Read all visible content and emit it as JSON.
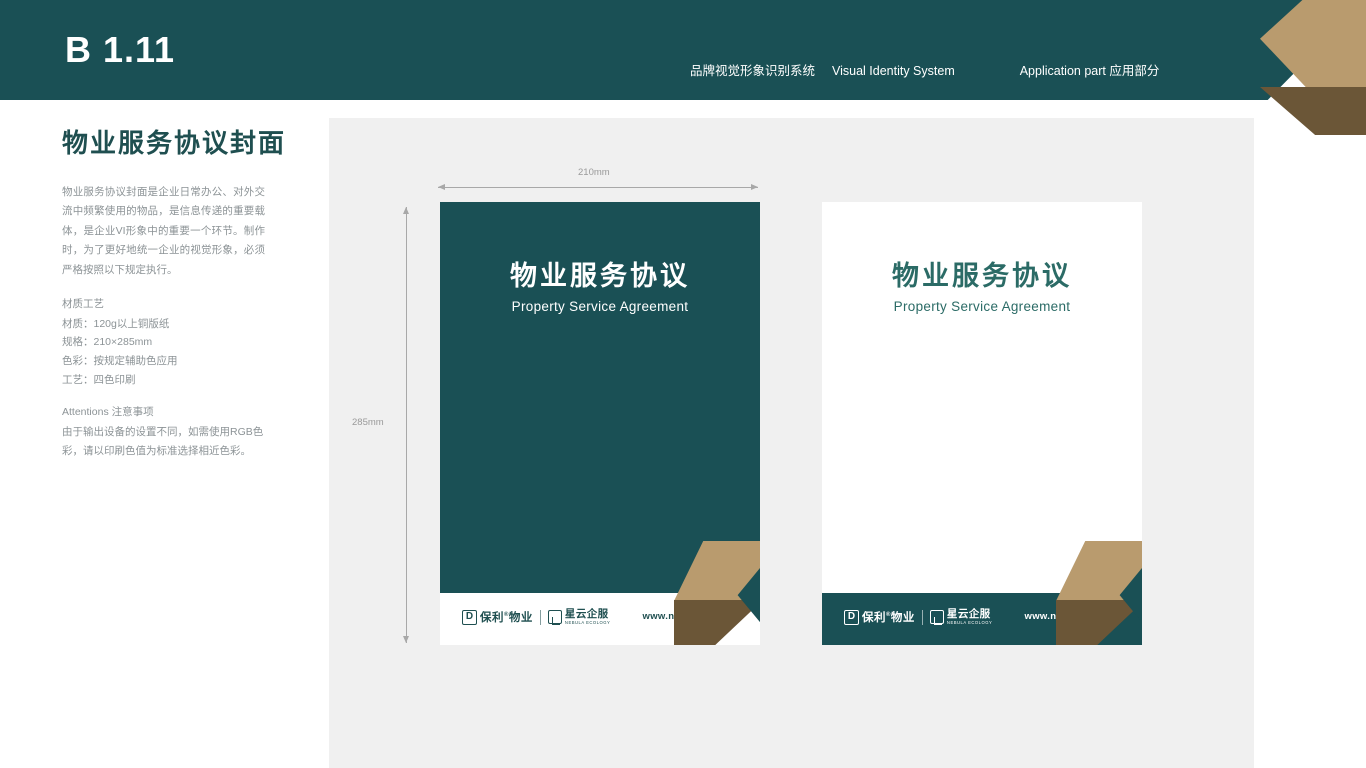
{
  "header": {
    "code": "B 1.11",
    "meta_cn": "品牌视觉形象识别系统",
    "meta_en": "Visual Identity System",
    "section": "Application part  应用部分",
    "bg_color": "#1a5055",
    "accent_tan": "#b99b6e",
    "accent_brown": "#6b5637"
  },
  "sidebar": {
    "title": "物业服务协议封面",
    "intro": "物业服务协议封面是企业日常办公、对外交流中频繁使用的物品，是信息传递的重要载体，是企业VI形象中的重要一个环节。制作时，为了更好地统一企业的视觉形象，必须严格按照以下规定执行。",
    "spec_heading": "材质工艺",
    "specs": [
      "材质：120g以上铜版纸",
      "规格：210×285mm",
      "色彩：按规定辅助色应用",
      "工艺：四色印刷"
    ],
    "attentions_heading": "Attentions 注意事项",
    "attentions_body": "由于输出设备的设置不同，如需使用RGB色彩，请以印刷色值为标准选择相近色彩。"
  },
  "stage": {
    "dim_width_label": "210mm",
    "dim_height_label": "285mm",
    "bg_color": "#f0f0f0"
  },
  "covers": [
    {
      "variant": "dark",
      "title_cn": "物业服务协议",
      "title_en": "Property Service Agreement",
      "url": "www.nebula.com",
      "logo_primary_mark": "D",
      "logo_primary_cn": "保利",
      "logo_primary_cn2": "物业",
      "logo_secondary_cn": "星云企服",
      "logo_secondary_en": "NEBULA ECOLOGY",
      "bg_color": "#1a5055",
      "footer_color": "#ffffff"
    },
    {
      "variant": "light",
      "title_cn": "物业服务协议",
      "title_en": "Property Service Agreement",
      "url": "www.nebula.com",
      "logo_primary_mark": "D",
      "logo_primary_cn": "保利",
      "logo_primary_cn2": "物业",
      "logo_secondary_cn": "星云企服",
      "logo_secondary_en": "NEBULA ECOLOGY",
      "bg_color": "#ffffff",
      "footer_color": "#1a5055"
    }
  ]
}
